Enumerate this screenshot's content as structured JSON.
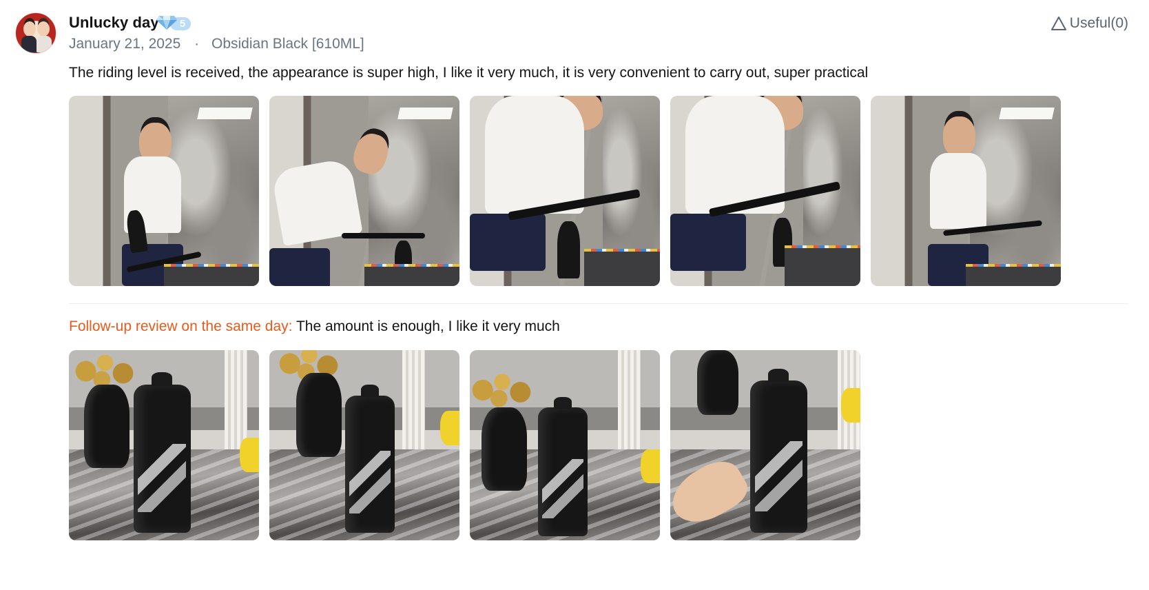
{
  "review": {
    "username": "Unlucky day",
    "level": "5",
    "date": "January 21, 2025",
    "separator": "·",
    "variant": "Obsidian Black [610ML]",
    "useful_label": "Useful(0)",
    "text": "The riding level is received, the appearance is super high, I like it very much, it is very convenient to carry out, super practical",
    "photos": [
      "review-photo-1",
      "review-photo-2",
      "review-photo-3",
      "review-photo-4",
      "review-photo-5"
    ],
    "followup": {
      "label": "Follow-up review on the same day:",
      "text": " The amount is enough, I like it very much",
      "photos": [
        "followup-photo-1",
        "followup-photo-2",
        "followup-photo-3",
        "followup-photo-4"
      ]
    }
  },
  "colors": {
    "followup_label": "#ea5a1b",
    "meta_text": "#6b7485",
    "badge": "#b9dcf7"
  },
  "icons": {
    "badge": "diamond-icon",
    "useful": "thumb-triangle-icon"
  }
}
